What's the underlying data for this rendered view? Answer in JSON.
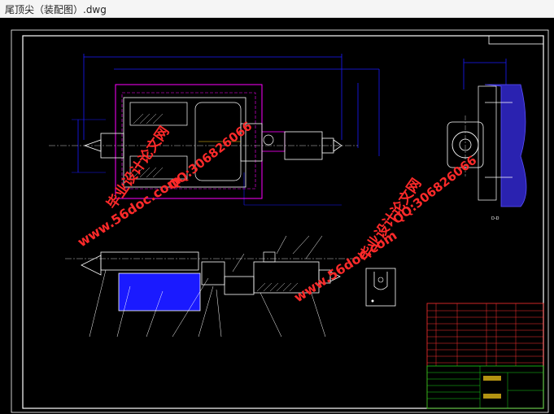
{
  "window": {
    "title": "尾顶尖（装配图）.dwg"
  },
  "drawing": {
    "view_label": "D-D",
    "watermarks": [
      {
        "text": "毕业设计论文网"
      },
      {
        "text": "QQ:306826066"
      },
      {
        "text": "www.56doc.com"
      },
      {
        "text": "毕业设计论文网"
      },
      {
        "text": "QQ:306826066"
      },
      {
        "text": "www.56doc.com"
      }
    ]
  },
  "colors": {
    "background": "#000000",
    "frame": "#ffffff",
    "part": "#ffffff",
    "dimension": "#1a1aff",
    "magenta": "#ff00ff",
    "watermark": "#ff2a2a",
    "titleblock_red": "#ff3030",
    "titleblock_green": "#19d419",
    "titleblock_yellow": "#ffd21a"
  }
}
